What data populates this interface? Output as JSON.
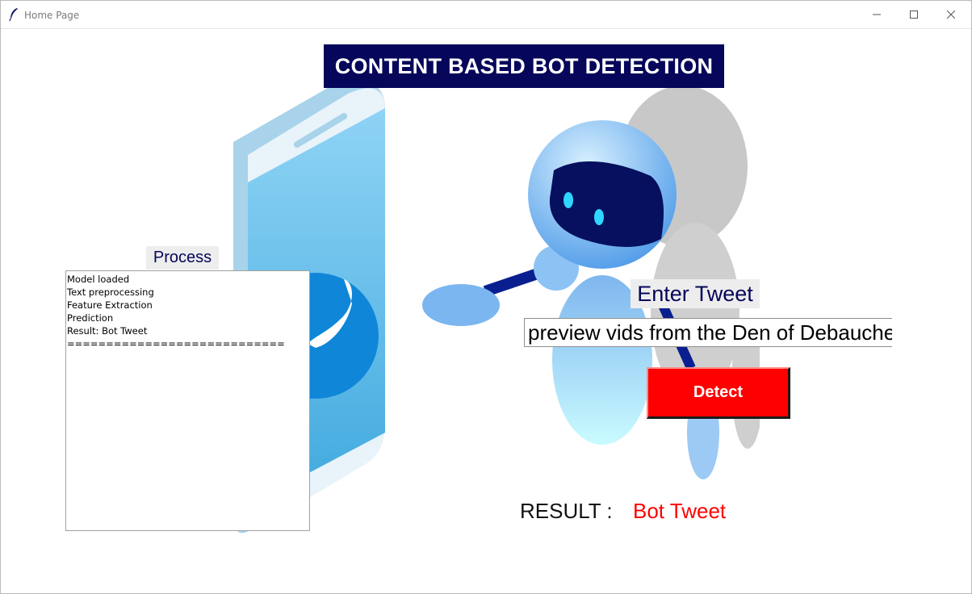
{
  "window": {
    "title": "Home Page",
    "controls": [
      "minimize-icon",
      "maximize-icon",
      "close-icon"
    ]
  },
  "header": {
    "title": "CONTENT BASED BOT DETECTION"
  },
  "process": {
    "label": "Process",
    "log": [
      "Model loaded",
      "Text preprocessing",
      "Feature Extraction",
      "Prediction",
      "Result: Bot Tweet",
      "============================"
    ]
  },
  "tweet": {
    "label": "Enter Tweet",
    "value": "preview vids from the Den of Debauchery"
  },
  "detect": {
    "label": "Detect"
  },
  "result": {
    "label": "RESULT :",
    "value": "Bot Tweet"
  },
  "colors": {
    "banner": "#06065a",
    "detect_button": "#ff0000",
    "result_value": "#ff0000",
    "label_text": "#06065a"
  }
}
